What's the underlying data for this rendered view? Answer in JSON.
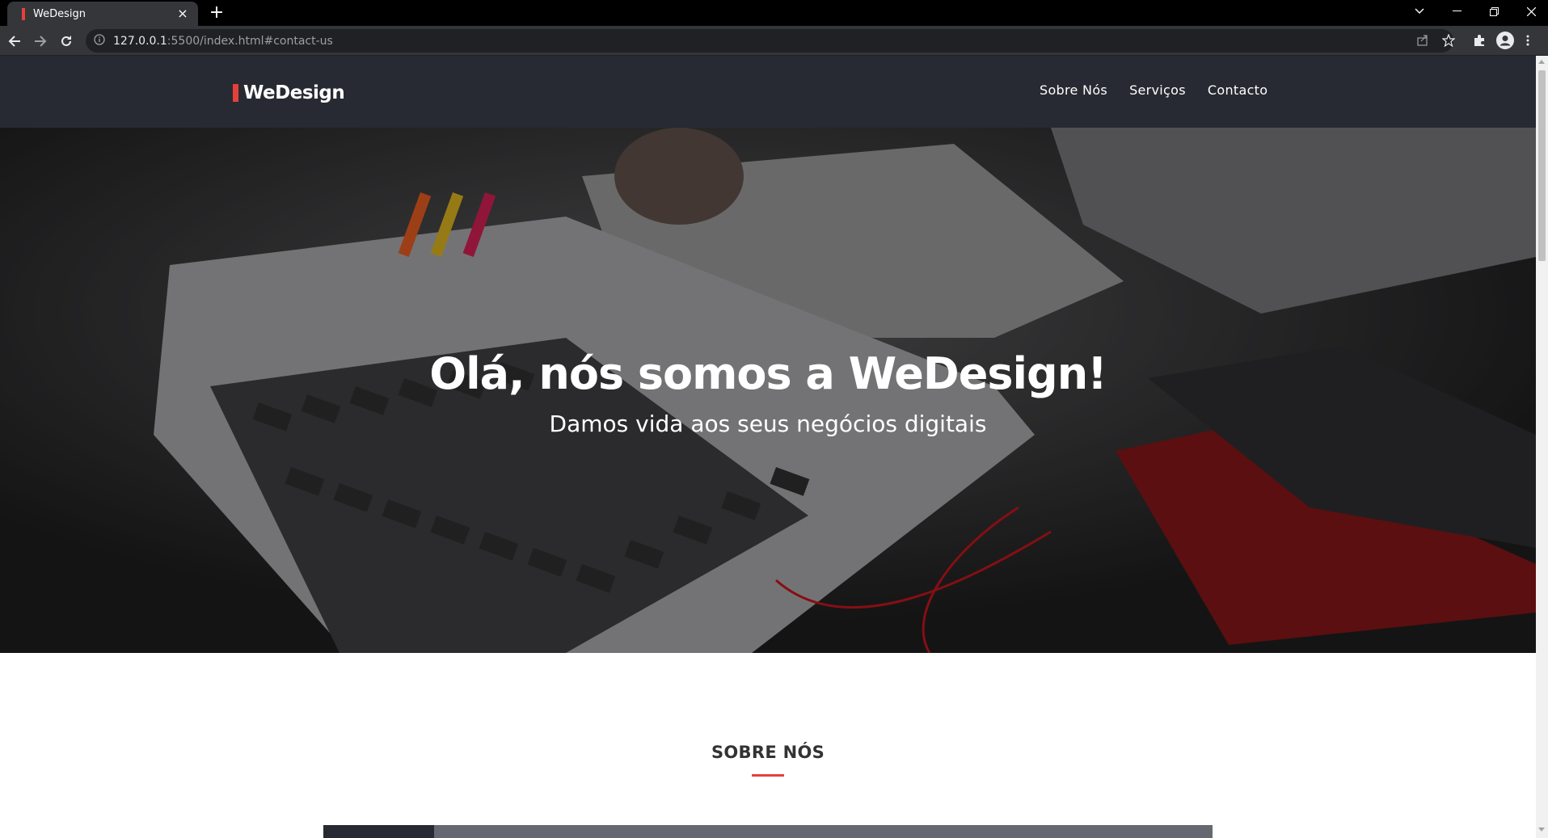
{
  "browser": {
    "tab_title": "WeDesign",
    "url_host": "127.0.0.1",
    "url_rest": ":5500/index.html#contact-us",
    "new_tab_label": "+",
    "close_tab_label": "×"
  },
  "header": {
    "logo_text": "WeDesign",
    "menu": [
      {
        "label": "Sobre Nós"
      },
      {
        "label": "Serviços"
      },
      {
        "label": "Contacto"
      }
    ]
  },
  "hero": {
    "title": "Olá, nós somos a WeDesign!",
    "subtitle": "Damos vida aos seus negócios digitais"
  },
  "about": {
    "title": "SOBRE NÓS"
  },
  "colors": {
    "accent": "#e4413a",
    "header_bg": "#272a32"
  }
}
